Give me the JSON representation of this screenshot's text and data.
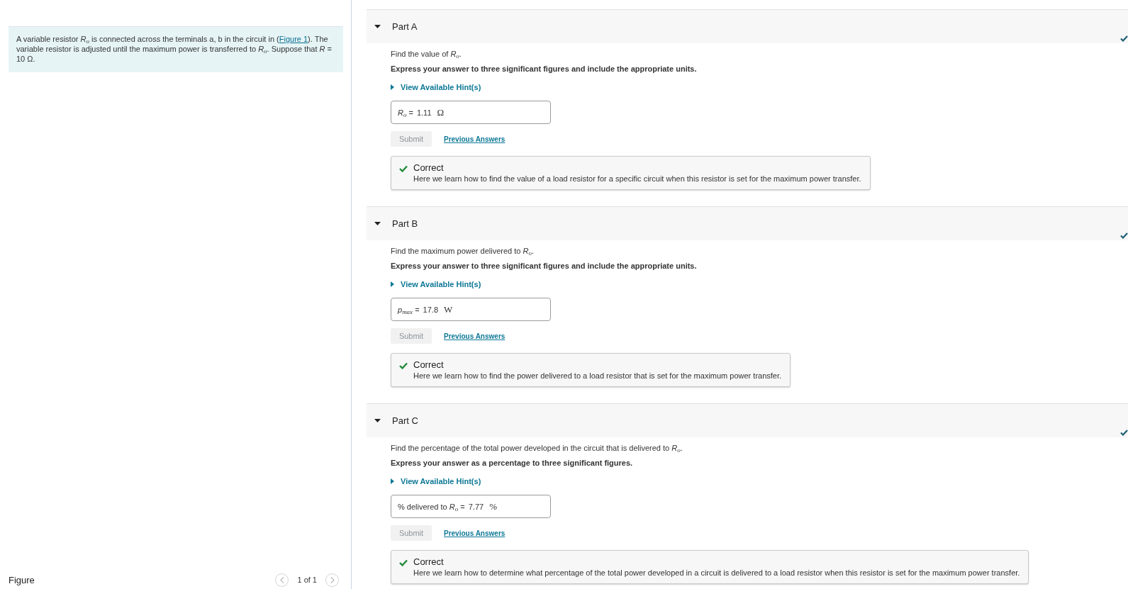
{
  "intro": {
    "text_before": "A variable resistor *R*$_{o}$ is connected across the terminals a, b in the circuit in (",
    "link": "Figure 1",
    "text_after": "). The variable resistor is adjusted until the maximum power is transferred to *R*$_{o}$. Suppose that *R* = 10 Ω."
  },
  "figure": {
    "title": "Figure",
    "pager": "1 of 1"
  },
  "parts": [
    {
      "title": "Part A",
      "expanded": true,
      "completed": true,
      "question": "Find the value of *R*$_{o}$.",
      "instructions": "Express your answer to three significant figures and include the appropriate units.",
      "hint_link": "View Available Hint(s)",
      "answer": {
        "label": "*R*$_{o}$ =",
        "value": "1.11",
        "unit": "Ω"
      },
      "submit": {
        "label": "Submit",
        "disabled": true
      },
      "previous_answers": "Previous Answers",
      "feedback": {
        "correct": true,
        "title": "Correct",
        "message": "Here we learn how to find the value of a load resistor for a specific circuit when this resistor is set for the maximum power transfer."
      }
    },
    {
      "title": "Part B",
      "expanded": true,
      "completed": true,
      "question": "Find the maximum power delivered to *R*$_{o}$.",
      "instructions": "Express your answer to three significant figures and include the appropriate units.",
      "hint_link": "View Available Hint(s)",
      "answer": {
        "label": "*p*$_{max}$ =",
        "value": "17.8",
        "unit": "W"
      },
      "submit": {
        "label": "Submit",
        "disabled": true
      },
      "previous_answers": "Previous Answers",
      "feedback": {
        "correct": true,
        "title": "Correct",
        "message": "Here we learn how to find the power delivered to a load resistor that is set for the maximum power transfer."
      }
    },
    {
      "title": "Part C",
      "expanded": true,
      "completed": true,
      "question": "Find the percentage of the total power developed in the circuit that is delivered to *R*$_{o}$.",
      "instructions": "Express your answer as a percentage to three significant figures.",
      "hint_link": "View Available Hint(s)",
      "answer": {
        "label": "% delivered to *R*$_{o}$ =",
        "value": "7.77",
        "unit": "%"
      },
      "submit": {
        "label": "Submit",
        "disabled": true
      },
      "previous_answers": "Previous Answers",
      "feedback": {
        "correct": true,
        "title": "Correct",
        "message": "Here we learn how to determine what percentage of the total power developed in a circuit is delivered to a load resistor when this resistor is set for the maximum power transfer."
      }
    }
  ]
}
